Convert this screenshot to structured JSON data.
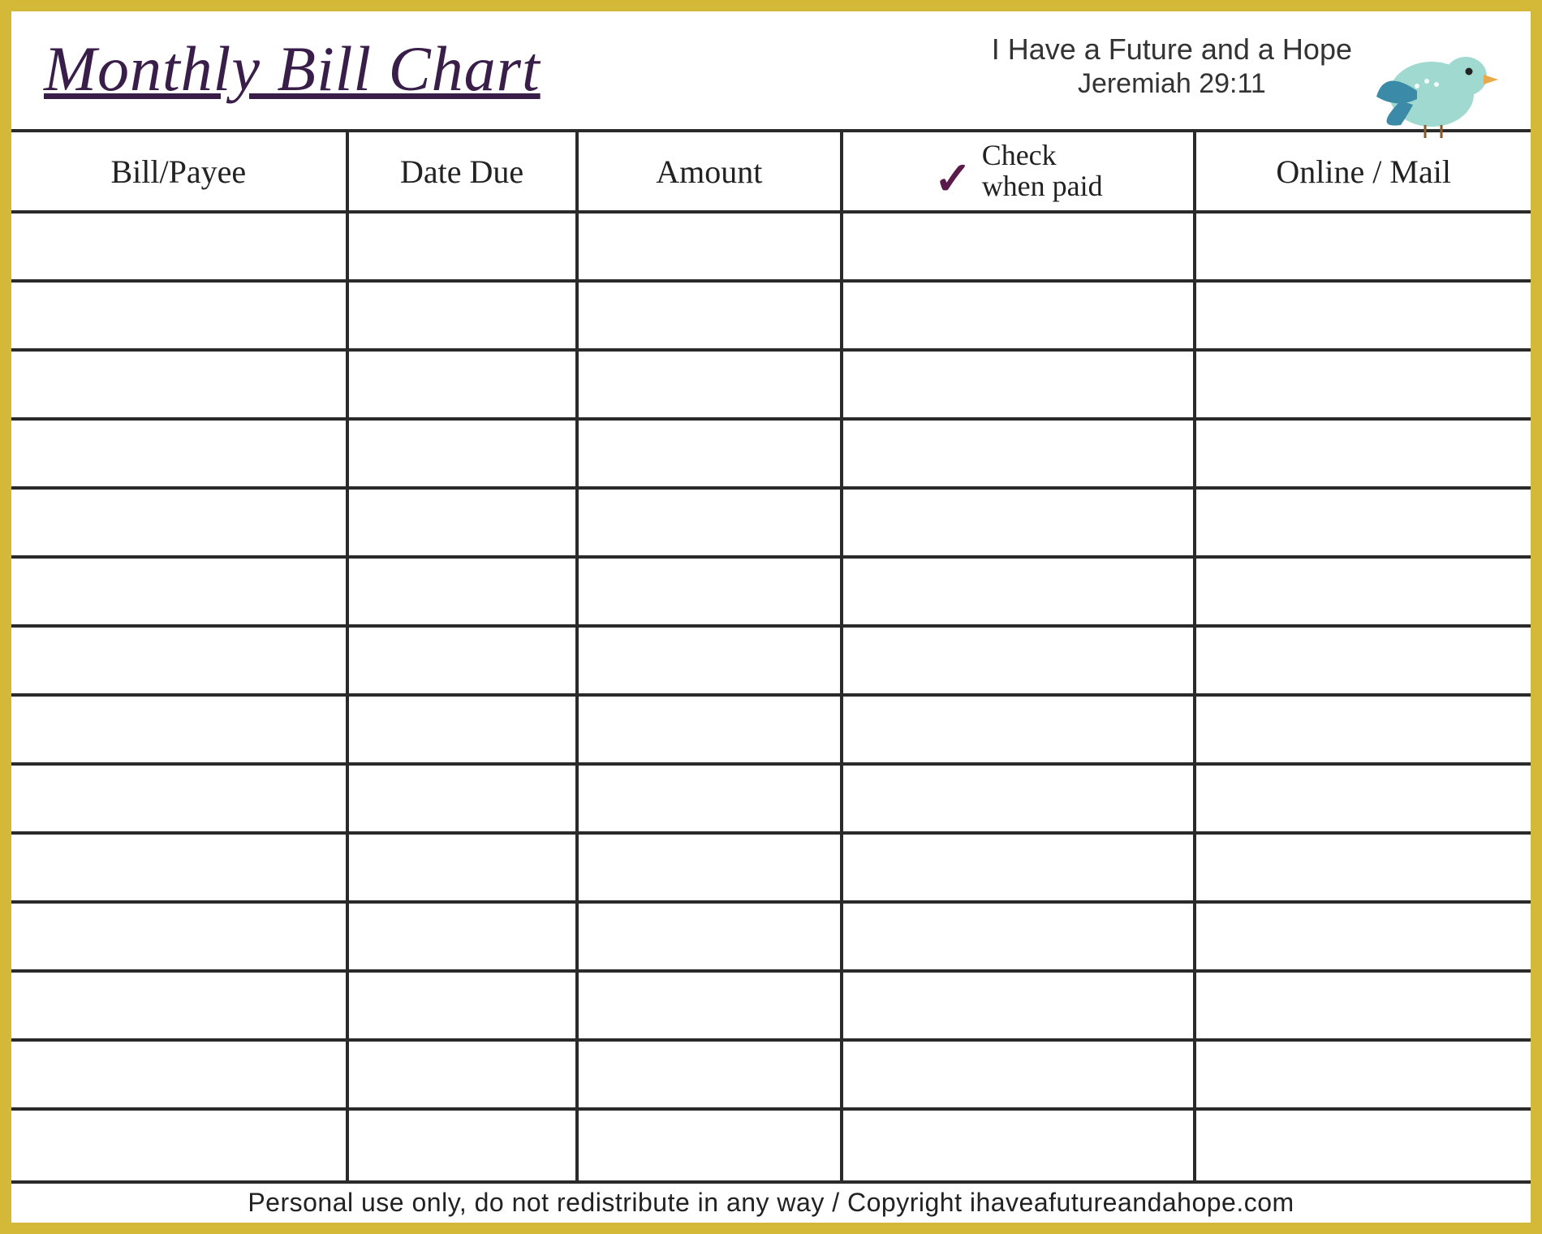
{
  "header": {
    "title": "Monthly Bill Chart",
    "tagline_line1": "I Have a Future and a Hope",
    "tagline_line2": "Jeremiah 29:11"
  },
  "columns": {
    "payee": "Bill/Payee",
    "date_due": "Date Due",
    "amount": "Amount",
    "check_label_line1": "Check",
    "check_label_line2": "when paid",
    "online_mail": "Online / Mail"
  },
  "rows": [
    {
      "payee": "",
      "date_due": "",
      "amount": "",
      "check": "",
      "online_mail": ""
    },
    {
      "payee": "",
      "date_due": "",
      "amount": "",
      "check": "",
      "online_mail": ""
    },
    {
      "payee": "",
      "date_due": "",
      "amount": "",
      "check": "",
      "online_mail": ""
    },
    {
      "payee": "",
      "date_due": "",
      "amount": "",
      "check": "",
      "online_mail": ""
    },
    {
      "payee": "",
      "date_due": "",
      "amount": "",
      "check": "",
      "online_mail": ""
    },
    {
      "payee": "",
      "date_due": "",
      "amount": "",
      "check": "",
      "online_mail": ""
    },
    {
      "payee": "",
      "date_due": "",
      "amount": "",
      "check": "",
      "online_mail": ""
    },
    {
      "payee": "",
      "date_due": "",
      "amount": "",
      "check": "",
      "online_mail": ""
    },
    {
      "payee": "",
      "date_due": "",
      "amount": "",
      "check": "",
      "online_mail": ""
    },
    {
      "payee": "",
      "date_due": "",
      "amount": "",
      "check": "",
      "online_mail": ""
    },
    {
      "payee": "",
      "date_due": "",
      "amount": "",
      "check": "",
      "online_mail": ""
    },
    {
      "payee": "",
      "date_due": "",
      "amount": "",
      "check": "",
      "online_mail": ""
    },
    {
      "payee": "",
      "date_due": "",
      "amount": "",
      "check": "",
      "online_mail": ""
    },
    {
      "payee": "",
      "date_due": "",
      "amount": "",
      "check": "",
      "online_mail": ""
    }
  ],
  "footer": "Personal use only, do not redistribute in any way / Copyright ihaveafutureandahope.com",
  "colors": {
    "border": "#d4b838",
    "title": "#3a1e4a",
    "checkmark": "#5a1a4a",
    "bird_body": "#9fd9cf",
    "bird_wing": "#3b8aa8",
    "bird_beak": "#e8a94a"
  }
}
